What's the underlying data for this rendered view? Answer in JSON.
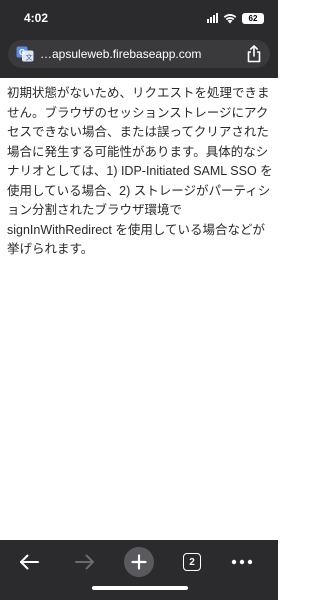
{
  "status_bar": {
    "time": "4:02",
    "battery": "62"
  },
  "address_bar": {
    "url": "…apsuleweb.firebaseapp.com",
    "translate_icon": "translate-icon",
    "share_icon": "share-icon"
  },
  "content": {
    "paragraph": "初期状態がないため、リクエストを処理できません。ブラウザのセッションストレージにアクセスできない場合、または誤ってクリアされた場合に発生する可能性があります。具体的なシナリオとしては、1) IDP-Initiated SAML SSO を使用している場合、2) ストレージがパーティション分割されたブラウザ環境で signInWithRedirect を使用している場合などが挙げられます。"
  },
  "toolbar": {
    "back_icon": "back-arrow-icon",
    "forward_icon": "forward-arrow-icon",
    "new_tab_icon": "plus-icon",
    "tab_count": "2",
    "menu_icon": "more-icon"
  },
  "colors": {
    "chrome_bar": "#2b2b2d",
    "url_field": "#3a3a3c",
    "text": "#2a2a2a",
    "disabled_icon": "#6b6b6f"
  }
}
